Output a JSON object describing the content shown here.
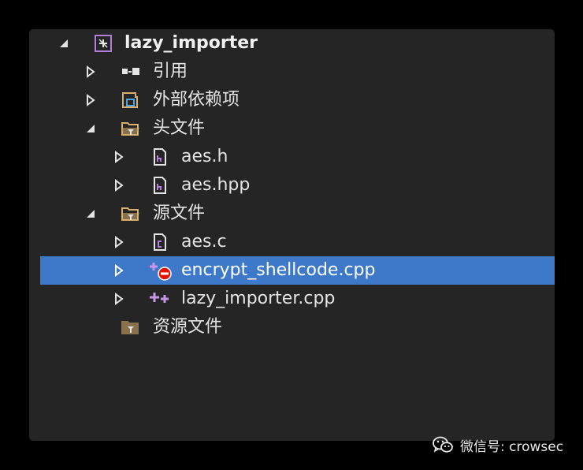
{
  "solution_explorer": {
    "project": {
      "label": "lazy_importer",
      "expanded": true,
      "icon": "vs-project-icon"
    },
    "items": [
      {
        "label": "引用",
        "icon": "references-icon",
        "expanded": false
      },
      {
        "label": "外部依赖项",
        "icon": "external-dependencies-icon",
        "expanded": false
      },
      {
        "label": "头文件",
        "icon": "folder-filter-icon",
        "expanded": true,
        "children": [
          {
            "label": "aes.h",
            "icon": "header-file-icon"
          },
          {
            "label": "aes.hpp",
            "icon": "header-file-icon"
          }
        ]
      },
      {
        "label": "源文件",
        "icon": "folder-filter-icon",
        "expanded": true,
        "children": [
          {
            "label": "aes.c",
            "icon": "c-file-icon"
          },
          {
            "label": "encrypt_shellcode.cpp",
            "icon": "cpp-file-excluded-icon",
            "selected": true
          },
          {
            "label": "lazy_importer.cpp",
            "icon": "cpp-file-icon"
          }
        ]
      },
      {
        "label": "资源文件",
        "icon": "folder-filter-icon"
      }
    ],
    "colors": {
      "background": "#252526",
      "selection": "#3e79c9",
      "text": "#e4e4e4",
      "cpp_icon": "#b27fd6",
      "folder_icon": "#d9b06b",
      "error_badge": "#e51400"
    }
  },
  "watermark": {
    "text": "微信号: crowsec",
    "icon": "wechat-icon"
  }
}
